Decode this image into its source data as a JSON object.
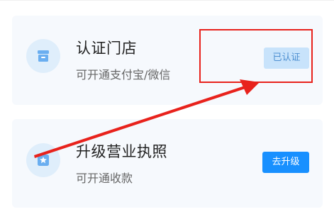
{
  "cards": [
    {
      "title": "认证门店",
      "subtitle": "可开通支付宝/微信",
      "action_label": "已认证",
      "icon": "store-icon"
    },
    {
      "title": "升级营业执照",
      "subtitle": "可开通收款",
      "action_label": "去升级",
      "icon": "license-star-icon"
    }
  ],
  "colors": {
    "card_background": "#f6f9fd",
    "icon_circle": "#dfeefb",
    "icon_fill": "#6aaef0",
    "verified_badge_bg": "#c8e3fb",
    "verified_badge_text": "#4d8fd1",
    "upgrade_button_bg": "#1890ff",
    "annotation_red": "#e8221c"
  }
}
